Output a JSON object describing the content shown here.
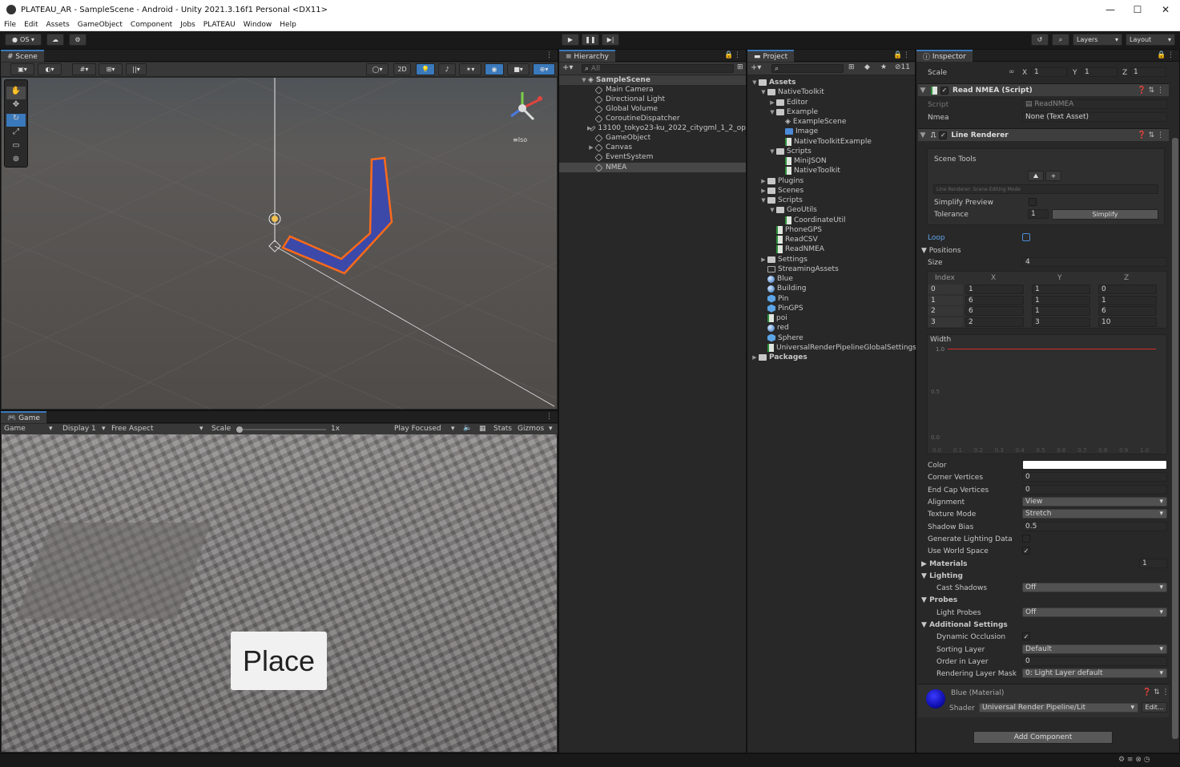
{
  "window": {
    "title": "PLATEAU_AR - SampleScene - Android - Unity 2021.3.16f1 Personal <DX11>",
    "minimize": "—",
    "maximize": "☐",
    "close": "✕"
  },
  "menu": [
    "File",
    "Edit",
    "Assets",
    "GameObject",
    "Component",
    "Jobs",
    "PLATEAU",
    "Window",
    "Help"
  ],
  "toolbar": {
    "account": "OS",
    "layers": "Layers",
    "layout": "Layout"
  },
  "scene": {
    "tab": "Scene",
    "mode2d": "2D",
    "iso": "≡Iso"
  },
  "game": {
    "tab": "Game",
    "mode": "Game",
    "display": "Display 1",
    "aspect": "Free Aspect",
    "scale_label": "Scale",
    "scale_value": "1x",
    "play_focused": "Play Focused",
    "stats": "Stats",
    "gizmos": "Gizmos",
    "place_button": "Place"
  },
  "hierarchy": {
    "tab": "Hierarchy",
    "search_placeholder": "All",
    "root": "SampleScene",
    "items": [
      "Main Camera",
      "Directional Light",
      "Global Volume",
      "CoroutineDispatcher",
      "13100_tokyo23-ku_2022_citygml_1_2_op",
      "GameObject",
      "Canvas",
      "EventSystem",
      "NMEA"
    ]
  },
  "project": {
    "tab": "Project",
    "hidden_count": "11",
    "items": [
      {
        "label": "Assets",
        "indent": 0,
        "icon": "folder",
        "arrow": "▼",
        "bold": true
      },
      {
        "label": "NativeToolkit",
        "indent": 1,
        "icon": "folder",
        "arrow": "▼"
      },
      {
        "label": "Editor",
        "indent": 2,
        "icon": "folder",
        "arrow": "▶"
      },
      {
        "label": "Example",
        "indent": 2,
        "icon": "folder",
        "arrow": "▼"
      },
      {
        "label": "ExampleScene",
        "indent": 3,
        "icon": "unity",
        "arrow": ""
      },
      {
        "label": "Image",
        "indent": 3,
        "icon": "image",
        "arrow": ""
      },
      {
        "label": "NativeToolkitExample",
        "indent": 3,
        "icon": "script",
        "arrow": ""
      },
      {
        "label": "Scripts",
        "indent": 2,
        "icon": "folder",
        "arrow": "▼"
      },
      {
        "label": "MiniJSON",
        "indent": 3,
        "icon": "script",
        "arrow": ""
      },
      {
        "label": "NativeToolkit",
        "indent": 3,
        "icon": "script",
        "arrow": ""
      },
      {
        "label": "Plugins",
        "indent": 1,
        "icon": "folder",
        "arrow": "▶"
      },
      {
        "label": "Scenes",
        "indent": 1,
        "icon": "folder",
        "arrow": "▶"
      },
      {
        "label": "Scripts",
        "indent": 1,
        "icon": "folder",
        "arrow": "▼"
      },
      {
        "label": "GeoUtils",
        "indent": 2,
        "icon": "folder",
        "arrow": "▼"
      },
      {
        "label": "CoordinateUtil",
        "indent": 3,
        "icon": "script",
        "arrow": ""
      },
      {
        "label": "PhoneGPS",
        "indent": 2,
        "icon": "script",
        "arrow": ""
      },
      {
        "label": "ReadCSV",
        "indent": 2,
        "icon": "script",
        "arrow": ""
      },
      {
        "label": "ReadNMEA",
        "indent": 2,
        "icon": "script",
        "arrow": ""
      },
      {
        "label": "Settings",
        "indent": 1,
        "icon": "folder",
        "arrow": "▶"
      },
      {
        "label": "StreamingAssets",
        "indent": 1,
        "icon": "folder-empty",
        "arrow": ""
      },
      {
        "label": "Blue",
        "indent": 1,
        "icon": "material",
        "arrow": ""
      },
      {
        "label": "Building",
        "indent": 1,
        "icon": "material",
        "arrow": ""
      },
      {
        "label": "Pin",
        "indent": 1,
        "icon": "prefab",
        "arrow": ""
      },
      {
        "label": "PinGPS",
        "indent": 1,
        "icon": "prefab",
        "arrow": ""
      },
      {
        "label": "poi",
        "indent": 1,
        "icon": "text",
        "arrow": ""
      },
      {
        "label": "red",
        "indent": 1,
        "icon": "material",
        "arrow": ""
      },
      {
        "label": "Sphere",
        "indent": 1,
        "icon": "prefab",
        "arrow": ""
      },
      {
        "label": "UniversalRenderPipelineGlobalSettings",
        "indent": 1,
        "icon": "settings",
        "arrow": ""
      },
      {
        "label": "Packages",
        "indent": 0,
        "icon": "folder",
        "arrow": "▶",
        "bold": true
      }
    ]
  },
  "inspector": {
    "tab": "Inspector",
    "scale": {
      "label": "Scale",
      "x": "1",
      "y": "1",
      "z": "1"
    },
    "read_nmea": {
      "title": "Read NMEA (Script)",
      "script_label": "Script",
      "script_value": "ReadNMEA",
      "nmea_label": "Nmea",
      "nmea_value": "None (Text Asset)"
    },
    "line_renderer": {
      "title": "Line Renderer",
      "scene_tools": "Scene Tools",
      "editing_mode": "Line Renderer: Scene Editing Mode",
      "simplify_preview": "Simplify Preview",
      "tolerance_label": "Tolerance",
      "tolerance_value": "1",
      "simplify_button": "Simplify",
      "loop": "Loop",
      "positions": "Positions",
      "size_label": "Size",
      "size_value": "4",
      "columns": [
        "Index",
        "X",
        "Y",
        "Z"
      ],
      "rows": [
        [
          "0",
          "1",
          "1",
          "0"
        ],
        [
          "1",
          "6",
          "1",
          "1"
        ],
        [
          "2",
          "6",
          "1",
          "6"
        ],
        [
          "3",
          "2",
          "3",
          "10"
        ]
      ],
      "width_label": "Width",
      "width_value": "1.0",
      "curve_y_labels": [
        "0.5",
        "0.0"
      ],
      "curve_x_labels": [
        "0.0",
        "0.1",
        "0.2",
        "0.3",
        "0.4",
        "0.5",
        "0.6",
        "0.7",
        "0.8",
        "0.9",
        "1.0"
      ],
      "props": [
        {
          "label": "Color",
          "value": "",
          "type": "color"
        },
        {
          "label": "Corner Vertices",
          "value": "0",
          "type": "field"
        },
        {
          "label": "End Cap Vertices",
          "value": "0",
          "type": "field"
        },
        {
          "label": "Alignment",
          "value": "View",
          "type": "drop"
        },
        {
          "label": "Texture Mode",
          "value": "Stretch",
          "type": "drop"
        },
        {
          "label": "Shadow Bias",
          "value": "0.5",
          "type": "field"
        },
        {
          "label": "Generate Lighting Data",
          "value": "",
          "type": "check"
        },
        {
          "label": "Use World Space",
          "value": "✓",
          "type": "check"
        }
      ],
      "materials_label": "Materials",
      "materials_count": "1",
      "lighting_label": "Lighting",
      "cast_shadows_label": "Cast Shadows",
      "cast_shadows_value": "Off",
      "probes_label": "Probes",
      "light_probes_label": "Light Probes",
      "light_probes_value": "Off",
      "additional_label": "Additional Settings",
      "dynamic_occlusion_label": "Dynamic Occlusion",
      "sorting_layer_label": "Sorting Layer",
      "sorting_layer_value": "Default",
      "order_label": "Order in Layer",
      "order_value": "0",
      "rendering_mask_label": "Rendering Layer Mask",
      "rendering_mask_value": "0: Light Layer default"
    },
    "material": {
      "name": "Blue (Material)",
      "shader_label": "Shader",
      "shader_value": "Universal Render Pipeline/Lit",
      "edit": "Edit..."
    },
    "add_component": "Add Component"
  },
  "colors": {
    "accent": "#3a79bb",
    "line_fill": "#3d49a8",
    "line_outline": "#ff6a1a",
    "curve": "#d0312d",
    "material_ball": "#1010b0"
  }
}
